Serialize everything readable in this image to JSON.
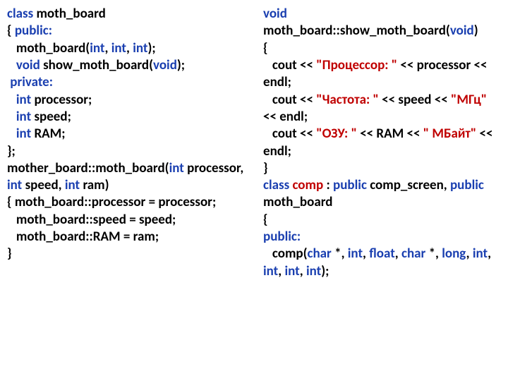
{
  "left": {
    "l1_class": "class",
    "l1_name": "moth_board",
    "l2_brace": "{ ",
    "l2_public": "public:",
    "l3_pre": "   moth_board(",
    "l3_int1": "int",
    "l3_sep1": ", ",
    "l3_int2": "int",
    "l3_sep2": ", ",
    "l3_int3": "int",
    "l3_post": ");",
    "l4_pre": "   ",
    "l4_void": "void",
    "l4_mid": " show_moth_board(",
    "l4_void2": "void",
    "l4_post": ");",
    "l5_pre": " ",
    "l5_private": "private:",
    "l6_pre": "   ",
    "l6_int": "int",
    "l6_post": " processor;",
    "l7_pre": "   ",
    "l7_int": "int",
    "l7_post": " speed;",
    "l8_pre": "   ",
    "l8_int": "int",
    "l8_post": " RAM;",
    "l9": "};",
    "l10a": "mother_board::moth_board(",
    "l10_int1": "int",
    "l10b": " processor, ",
    "l10_int2": "int",
    "l10c": " speed, ",
    "l10_int3": "int",
    "l10d": " ram)",
    "l11": "{ moth_board::processor = processor;",
    "l12": "   moth_board::speed = speed;",
    "l13": "   moth_board::RAM = ram;",
    "l14": "}"
  },
  "right": {
    "r1_void": "void",
    "r1_rest": " moth_board::show_moth_board(",
    "r1_void2": "void",
    "r1_post": ")",
    "r2": "{",
    "r3_pre": "   cout << ",
    "r3_str": "\"Процессор: \"",
    "r3_post": " << processor << endl;",
    "r4_pre": "   cout << ",
    "r4_str1": "\"Частота: \"",
    "r4_mid": " << speed << ",
    "r4_str2": "\"МГц\"",
    "r4_post": " << endl;",
    "r5_pre": "   cout << ",
    "r5_str1": "\"ОЗУ: \"",
    "r5_mid": " << RAM << ",
    "r5_str2": "\" МБайт\"",
    "r5_post": " << endl;",
    "r6": "}",
    "r7_class": "class",
    "r7_name": " comp ",
    "r7_sep": ": ",
    "r7_pub1": "public",
    "r7_scr": " comp_screen, ",
    "r7_pub2": "public",
    "r7_mb": " moth_board",
    "r8": "{",
    "r9_public": "public:",
    "r10_pre": "   comp(",
    "r10_char1": "char",
    "r10_a": " *, ",
    "r10_int1": "int",
    "r10_b": ", ",
    "r10_float": "float",
    "r10_c": ", ",
    "r10_char2": "char",
    "r10_d": " *, ",
    "r10_long": "long",
    "r10_e": ", ",
    "r10_int2": "int",
    "r10_f": ", ",
    "r10_int3": "int",
    "r10_g": ", ",
    "r10_int4": "int",
    "r10_h": ", ",
    "r10_int5": "int",
    "r10_post": ");"
  }
}
